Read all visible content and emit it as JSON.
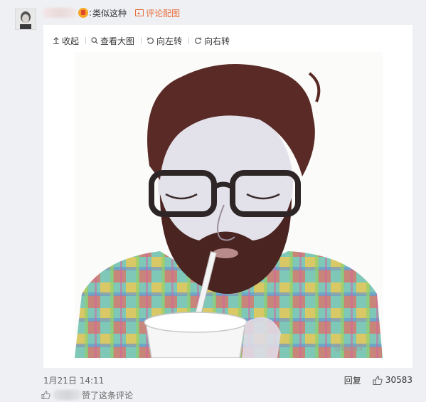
{
  "comment": {
    "text": "类似这种",
    "separator": ":",
    "image_tag_label": "评论配图"
  },
  "toolbar": {
    "collapse_label": "收起",
    "view_large_label": "查看大图",
    "rotate_left_label": "向左转",
    "rotate_right_label": "向右转"
  },
  "image": {
    "subject": "colored-pencil illustration of bearded man with glasses drinking through a straw, plaid shirt",
    "watermark": "@面西西"
  },
  "footer": {
    "date": "1月21日 14:11",
    "reply_label": "回复",
    "like_count": "30583"
  },
  "liked_by": {
    "suffix": "赞了这条评论"
  },
  "colors": {
    "background": "#eef0f3",
    "panel": "#ffffff",
    "tag": "#e86c3a"
  }
}
